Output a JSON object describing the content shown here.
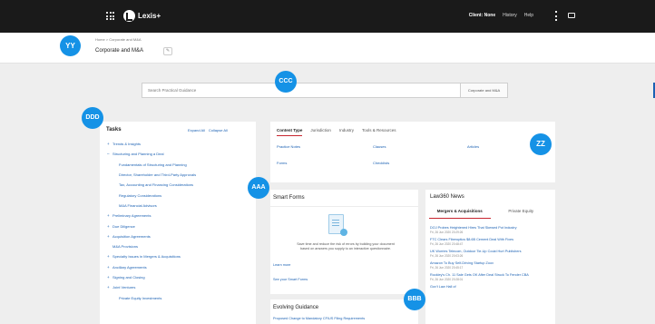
{
  "topbar": {
    "brand": "Lexis+",
    "nav": [
      "Client: None",
      "History",
      "Help"
    ]
  },
  "header": {
    "breadcrumb": "Home  >  Corporate and M&A",
    "title": "Corporate and M&A",
    "edit_icon": "pencil-icon"
  },
  "search": {
    "placeholder": "Search Practical Guidance",
    "scope": "Corporate and M&A",
    "button_icon": "search-icon"
  },
  "tasks": {
    "title": "Tasks",
    "expand_all": "Expand All",
    "collapse_all": "Collapse All",
    "items": [
      {
        "marker": "+",
        "label": "Trends & Insights",
        "level": 0
      },
      {
        "marker": "–",
        "label": "Structuring and Planning a Deal",
        "level": 0
      },
      {
        "marker": "",
        "label": "Fundamentals of Structuring and Planning",
        "level": 1
      },
      {
        "marker": "",
        "label": "Director, Shareholder and Third-Party Approvals",
        "level": 1
      },
      {
        "marker": "",
        "label": "Tax, Accounting and Financing Considerations",
        "level": 1
      },
      {
        "marker": "",
        "label": "Regulatory Considerations",
        "level": 1
      },
      {
        "marker": "",
        "label": "M&A Financial Advisors",
        "level": 1
      },
      {
        "marker": "+",
        "label": "Preliminary Agreements",
        "level": 0
      },
      {
        "marker": "+",
        "label": "Due Diligence",
        "level": 0
      },
      {
        "marker": "+",
        "label": "Acquisition Agreements",
        "level": 0
      },
      {
        "marker": "",
        "label": "M&A Provisions",
        "level": 0
      },
      {
        "marker": "+",
        "label": "Specialty Issues in Mergers & Acquisitions",
        "level": 0
      },
      {
        "marker": "+",
        "label": "Ancillary Agreements",
        "level": 0
      },
      {
        "marker": "+",
        "label": "Signing and Closing",
        "level": 0
      },
      {
        "marker": "+",
        "label": "Joint Ventures",
        "level": 0
      },
      {
        "marker": "",
        "label": "Private Equity Investments",
        "level": 1
      }
    ]
  },
  "content_type": {
    "tabs": [
      "Content Type",
      "Jurisdiction",
      "Industry",
      "Tools & Resources"
    ],
    "links": [
      "Practice Notes",
      "Clauses",
      "Articles",
      "Forms",
      "Checklists"
    ]
  },
  "smart_forms": {
    "title": "Smart Forms",
    "description": "Save time and reduce the risk of errors by building your document based on answers you supply to an interactive questionnaire.",
    "learn_more": "Learn more",
    "see_all": "See your Smart Forms"
  },
  "evolving": {
    "title": "Evolving Guidance",
    "item": "Proposed Change to Mandatory CFIUS Filing Requirements"
  },
  "news": {
    "title": "Law360 News",
    "tabs": [
      "Mergers & Acquisitions",
      "Private Equity"
    ],
    "items": [
      {
        "headline": "DOJ Probes Heightened Hires That Skewed Pot Industry",
        "date": "Fri, 26 Jun 2020 20:29:26"
      },
      {
        "headline": "FTC Clears Fiberoptics $8.6B Cement Deal With Fixes",
        "date": "Fri, 26 Jun 2020 20:48:47"
      },
      {
        "headline": "UK Worries Telecom, Outdoor Tie-Up Could Hurt Publishers",
        "date": "Fri, 26 Jun 2020 20:03:26"
      },
      {
        "headline": "Amazon To Buy Self-Driving Startup Zoox",
        "date": "Fri, 26 Jun 2020 20:45:17"
      },
      {
        "headline": "Rockley's Ch. 11 Sale Gets OK After Deal Struck To Fender CBA",
        "date": "Fri, 26 Jun 2020 20:28:01"
      },
      {
        "headline": "Gov't Law Hall of",
        "date": ""
      }
    ]
  },
  "badges": [
    "YY",
    "CCC",
    "DDD",
    "ZZ",
    "AAA",
    "BBB"
  ],
  "colors": {
    "topbar": "#1a1a1a",
    "accent_blue": "#1b61b3",
    "badge_blue": "#1592e6",
    "active_tab_red": "#c7252f"
  }
}
